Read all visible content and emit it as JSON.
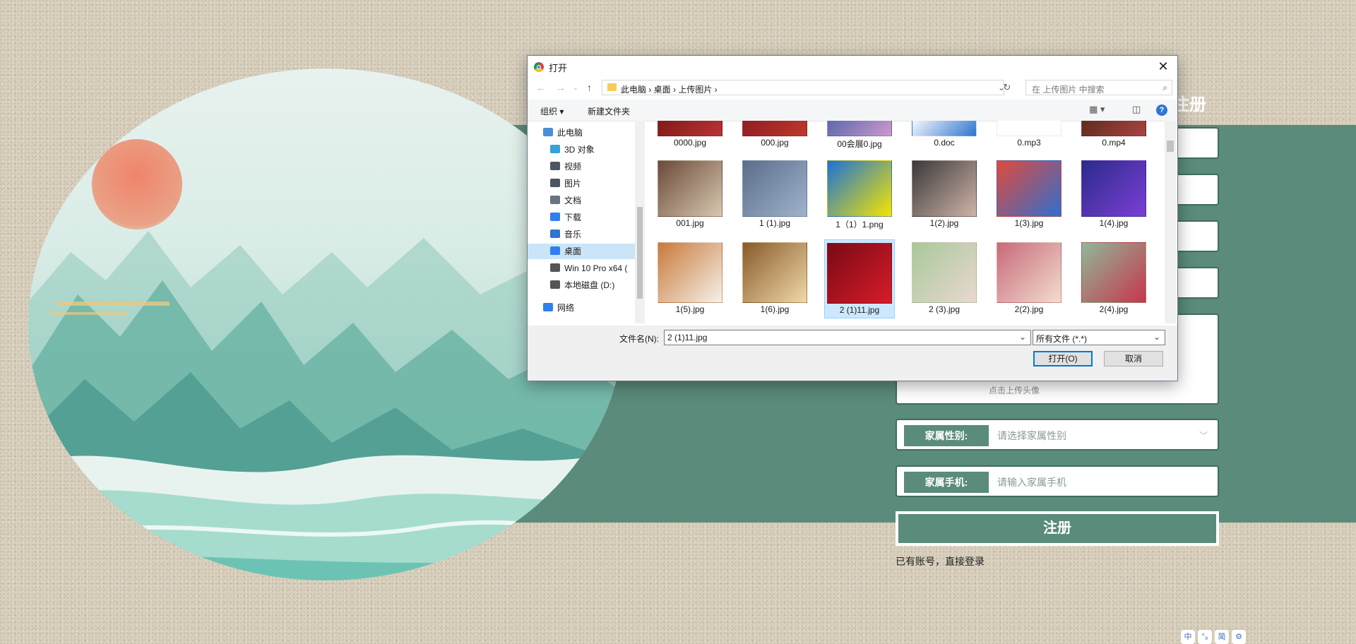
{
  "page": {
    "title": "注册",
    "avatar_hint": "点击上传头像",
    "gender_label": "家属性别:",
    "gender_placeholder": "请选择家属性别",
    "phone_label": "家属手机:",
    "phone_placeholder": "请输入家属手机",
    "register_label": "注册",
    "login_link": "已有账号，直接登录",
    "corner_icons": [
      "中",
      "°₉",
      "简",
      "⚙"
    ]
  },
  "dialog": {
    "title": "打开",
    "close": "✕",
    "breadcrumb": "此电脑  ›  桌面  ›  上传图片  ›",
    "search_placeholder": "在 上传图片 中搜索",
    "organize": "组织 ▾",
    "new_folder": "新建文件夹",
    "help": "?",
    "sidebar": [
      {
        "label": "此电脑",
        "icon": "computer-icon",
        "color": "#4a8fd8"
      },
      {
        "label": "3D 对象",
        "icon": "cube-icon",
        "color": "#37a0d8"
      },
      {
        "label": "视频",
        "icon": "video-icon",
        "color": "#4b5563"
      },
      {
        "label": "图片",
        "icon": "picture-icon",
        "color": "#4b5563"
      },
      {
        "label": "文档",
        "icon": "document-icon",
        "color": "#6b7280"
      },
      {
        "label": "下载",
        "icon": "download-icon",
        "color": "#2f80ed"
      },
      {
        "label": "音乐",
        "icon": "music-icon",
        "color": "#2f74cf"
      },
      {
        "label": "桌面",
        "icon": "desktop-icon",
        "color": "#2f80ed"
      },
      {
        "label": "Win 10 Pro x64 (",
        "icon": "drive-icon",
        "color": "#555"
      },
      {
        "label": "本地磁盘 (D:)",
        "icon": "disk-icon",
        "color": "#555"
      },
      {
        "label": "网络",
        "icon": "network-icon",
        "color": "#2f80ed"
      }
    ],
    "files": [
      {
        "name": "0000.jpg",
        "colors": [
          "#7a1a1a",
          "#b33"
        ]
      },
      {
        "name": "000.jpg",
        "colors": [
          "#8a1c24",
          "#c0392b"
        ]
      },
      {
        "name": "00会展0.jpg",
        "colors": [
          "#5566aa",
          "#c9c"
        ]
      },
      {
        "name": "0.doc",
        "colors": [
          "#ffffff",
          "#2f74cf"
        ]
      },
      {
        "name": "0.mp3",
        "colors": [
          "#ffffff",
          "#ffffff"
        ]
      },
      {
        "name": "0.mp4",
        "colors": [
          "#5a2a1a",
          "#a44"
        ]
      },
      {
        "name": "001.jpg",
        "colors": [
          "#6b4a3a",
          "#d8c8b0"
        ]
      },
      {
        "name": "1 (1).jpg",
        "colors": [
          "#5a6e8a",
          "#9fb3cc"
        ]
      },
      {
        "name": "1（1）1.png",
        "colors": [
          "#1c72d6",
          "#f5e500"
        ]
      },
      {
        "name": "1(2).jpg",
        "colors": [
          "#3a3a3a",
          "#cfb3a8"
        ]
      },
      {
        "name": "1(3).jpg",
        "colors": [
          "#e04a3a",
          "#2f6fd0"
        ]
      },
      {
        "name": "1(4).jpg",
        "colors": [
          "#2b2b8a",
          "#7b3fd6"
        ]
      },
      {
        "name": "1(5).jpg",
        "colors": [
          "#c97a3a",
          "#f5f0ea"
        ]
      },
      {
        "name": "1(6).jpg",
        "colors": [
          "#8a5a2a",
          "#f0d8a8"
        ]
      },
      {
        "name": "2 (1)11.jpg",
        "colors": [
          "#7a0a14",
          "#d61c2a"
        ]
      },
      {
        "name": "2 (3).jpg",
        "colors": [
          "#a9c89a",
          "#e8d8d0"
        ]
      },
      {
        "name": "2(2).jpg",
        "colors": [
          "#c86a7a",
          "#f2dccf"
        ]
      },
      {
        "name": "2(4).jpg",
        "colors": [
          "#8fb89a",
          "#c7364a"
        ]
      }
    ],
    "selected_file": "2 (1)11.jpg",
    "filename_label": "文件名(N):",
    "filename_value": "2 (1)11.jpg",
    "filetype_value": "所有文件 (*.*)",
    "open_button": "打开(O)",
    "cancel_button": "取消"
  }
}
